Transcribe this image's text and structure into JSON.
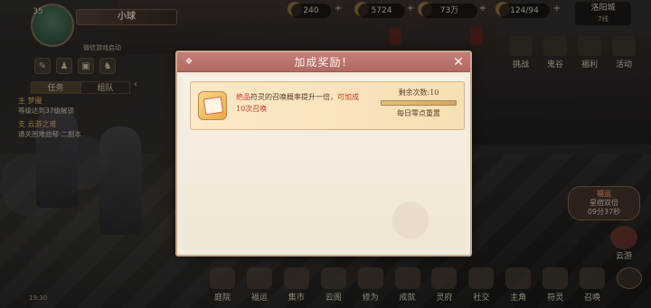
{
  "hud": {
    "player_level": "35",
    "player_name": "小球",
    "avatar_caption": "微信游戏启动",
    "resources": [
      {
        "value": "240"
      },
      {
        "value": "5724"
      },
      {
        "value": "73万"
      },
      {
        "value": "124/94"
      }
    ],
    "location": {
      "name": "洛阳城",
      "line": "7线"
    },
    "top_menu": [
      {
        "label": "挑战",
        "icon": "challenge-icon"
      },
      {
        "label": "鬼谷",
        "icon": "valley-icon"
      },
      {
        "label": "福利",
        "icon": "welfare-icon"
      },
      {
        "label": "活动",
        "icon": "event-icon"
      }
    ]
  },
  "task_panel": {
    "tabs": [
      "任务",
      "组队"
    ],
    "items": [
      {
        "title": "主 梦魇",
        "detail": "等级达到37级解锁"
      },
      {
        "title": "支 云游之难",
        "detail": "通关困难曲郁·二副本"
      }
    ]
  },
  "timer": {
    "tag": "福运",
    "text": "星宿双倍",
    "time": "09分37秒"
  },
  "cloud_button": {
    "label": "云游"
  },
  "bottom_menu": [
    {
      "label": "庭院",
      "icon": "courtyard-icon"
    },
    {
      "label": "福运",
      "icon": "fortune-icon"
    },
    {
      "label": "集市",
      "icon": "market-icon"
    },
    {
      "label": "云阁",
      "icon": "cloud-pavilion-icon"
    },
    {
      "label": "修为",
      "icon": "cultivation-icon"
    },
    {
      "label": "成就",
      "icon": "achievement-icon"
    },
    {
      "label": "灵府",
      "icon": "spirit-house-icon"
    },
    {
      "label": "社交",
      "icon": "social-icon"
    },
    {
      "label": "主角",
      "icon": "hero-icon"
    },
    {
      "label": "符灵",
      "icon": "talisman-icon"
    },
    {
      "label": "召唤",
      "icon": "summon-icon"
    }
  ],
  "status_row": "19:30",
  "dialog": {
    "title": "加成奖励！",
    "bonus": {
      "highlight": "绝品",
      "text_part1": "符灵的召唤概率提升一倍，",
      "text_part2": "可加成10次召唤",
      "remaining_label": "剩余次数:10",
      "remaining_fraction": 1.0,
      "reset_label": "每日零点重置"
    }
  },
  "colors": {
    "dialog_header": "#b06a63",
    "dialog_bg": "#f2ebde",
    "bonus_red": "#d03a28",
    "card_bg": "#f6dfb3"
  }
}
